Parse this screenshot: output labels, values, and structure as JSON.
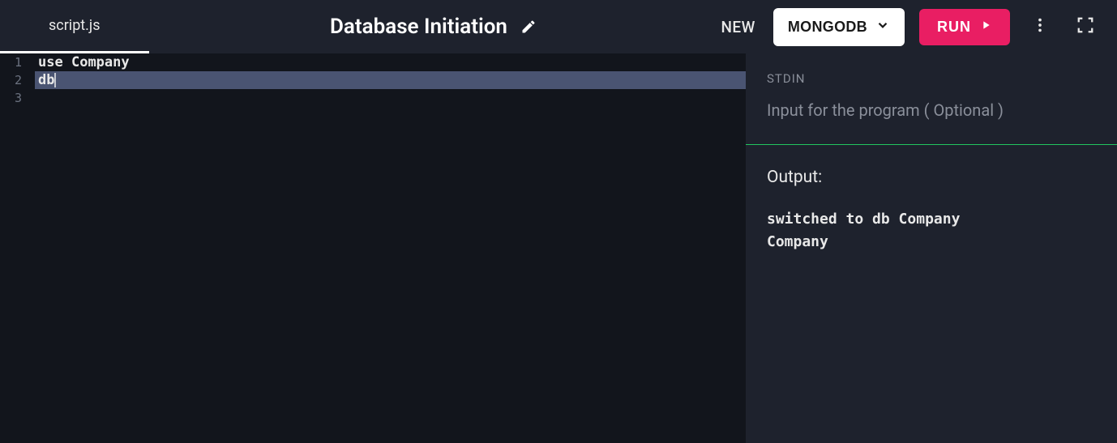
{
  "header": {
    "tab_filename": "script.js",
    "title": "Database Initiation",
    "new_label": "NEW",
    "language_label": "MONGODB",
    "run_label": "RUN"
  },
  "editor": {
    "lines": [
      {
        "num": "1",
        "text": "use Company",
        "active": false
      },
      {
        "num": "2",
        "text": "db",
        "active": true
      },
      {
        "num": "3",
        "text": "",
        "active": false
      }
    ]
  },
  "stdin": {
    "label": "STDIN",
    "placeholder": "Input for the program ( Optional )"
  },
  "output": {
    "label": "Output:",
    "text": "switched to db Company\nCompany"
  }
}
